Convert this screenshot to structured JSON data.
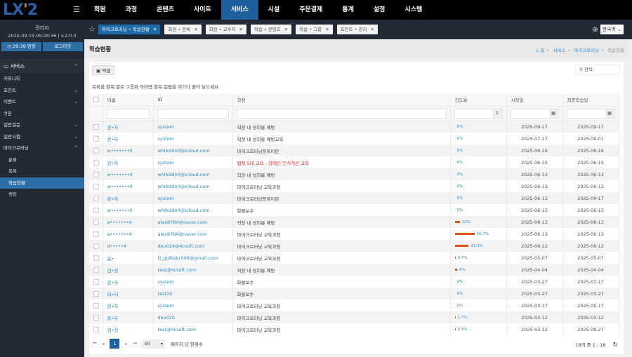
{
  "app": {
    "logo": "LX2"
  },
  "nav": {
    "items": [
      "회원",
      "과정",
      "콘텐츠",
      "사이트",
      "서비스",
      "시설",
      "주문결제",
      "통계",
      "설정",
      "시스템"
    ],
    "active": "서비스"
  },
  "user": {
    "name": "관리자",
    "datetime": "2025-09-19 09:28:36 | v.2.0.0",
    "extend": "29:39 연장",
    "logout": "로그아웃"
  },
  "sidebar": {
    "group": "서비스",
    "items": [
      {
        "label": "커뮤니티",
        "chev": ""
      },
      {
        "label": "포인트",
        "chev": "⌄"
      },
      {
        "label": "이벤트",
        "chev": "⌄"
      },
      {
        "label": "쿠폰",
        "chev": ""
      },
      {
        "label": "일반설문",
        "chev": "⌄"
      },
      {
        "label": "일반시험",
        "chev": "⌄"
      },
      {
        "label": "마이크로러닝",
        "chev": "^"
      }
    ],
    "sub": [
      "분류",
      "목록",
      "학습현황",
      "랭킹"
    ],
    "active": "학습현황"
  },
  "tabs": [
    {
      "label": "마이크로러닝 • 학습현황",
      "active": true
    },
    {
      "label": "회원 • 전체"
    },
    {
      "label": "회원 • 교수자"
    },
    {
      "label": "학습 • 콘텐츠"
    },
    {
      "label": "학습 • 그룹"
    },
    {
      "label": "포인트 • 관리"
    }
  ],
  "language": "한국어",
  "page": {
    "title": "학습현황",
    "breadcrumb": [
      "홈",
      "서비스",
      "마이크로러닝",
      "학습현황"
    ]
  },
  "toolbar": {
    "excel": "엑셀",
    "search_placeholder": "검색",
    "group_hint": "목록을 항목 별로 그룹화 하려면 항목 컬럼을 여기다 끌어 놓으세요."
  },
  "table": {
    "columns": [
      "이름",
      "ID",
      "과정",
      "진도율",
      "시작일",
      "최종학습일"
    ],
    "rows": [
      {
        "name": "관•자",
        "id": "system",
        "course": "직장 내 성희롱 예방",
        "progress": 0,
        "progress_label": "0%",
        "start": "2025-09-17",
        "last": "2025-09-17"
      },
      {
        "name": "관•자",
        "id": "system",
        "course": "직장 내 성희롱 예방교육",
        "progress": 0,
        "progress_label": "0%",
        "start": "2025-07-17",
        "last": "2025-09-01"
      },
      {
        "name": "w•••••••0",
        "id": "whtkddn0@icloud.com",
        "course": "마이크로러닝등록이란",
        "progress": 0,
        "progress_label": "0%",
        "start": "2025-06-16",
        "last": "2025-06-16"
      },
      {
        "name": "관•자",
        "id": "system",
        "course": "법정 5대 교육 - 장애인 인식개선 교육",
        "highlight": true,
        "progress": 0,
        "progress_label": "0%",
        "start": "2025-06-15",
        "last": "2025-06-15"
      },
      {
        "name": "w•••••••0",
        "id": "whtkddn0@icloud.com",
        "course": "직장 내 성희롱 예방",
        "progress": 0,
        "progress_label": "0%",
        "start": "2025-06-13",
        "last": "2025-06-13"
      },
      {
        "name": "w•••••••0",
        "id": "whtkddn0@icloud.com",
        "course": "마이크로러닝 교육과정",
        "progress": 0,
        "progress_label": "0%",
        "start": "2025-06-13",
        "last": "2025-06-13"
      },
      {
        "name": "관•자",
        "id": "system",
        "course": "마이크로러닝등록이란",
        "progress": 0,
        "progress_label": "0%",
        "start": "2025-06-13",
        "last": "2025-09-17"
      },
      {
        "name": "w•••••••0",
        "id": "whtkddn0@icloud.com",
        "course": "화물보수",
        "progress": 0,
        "progress_label": "0%",
        "start": "2025-06-13",
        "last": "2025-06-13"
      },
      {
        "name": "a•••••••4",
        "id": "alex8784@naver.com",
        "course": "직장 내 성희롱 예방",
        "progress": 12,
        "progress_label": "12%",
        "start": "2025-06-13",
        "last": "2025-06-13"
      },
      {
        "name": "a•••••••4",
        "id": "alex8784@naver.com",
        "course": "마이크로러닝 교육과정",
        "progress": 46.7,
        "progress_label": "46.7%",
        "start": "2025-06-13",
        "last": "2025-06-13"
      },
      {
        "name": "d•••••4",
        "id": "dev024@4csoft.com",
        "course": "마이크로러닝 교육과정",
        "progress": 33.3,
        "progress_label": "33.3%",
        "start": "2025-06-12",
        "last": "2025-06-12"
      },
      {
        "name": "윤•",
        "id": "G_gidbstjr000@gmail.com",
        "course": "마이크로러닝 교육과정",
        "progress": 0.7,
        "progress_label": "0.7%",
        "start": "2025-05-07",
        "last": "2025-05-07"
      },
      {
        "name": "김•성",
        "id": "test@4csoft.com",
        "course": "직장 내 성희롱 예방",
        "progress": 6,
        "progress_label": "6%",
        "start": "2025-04-04",
        "last": "2025-04-04"
      },
      {
        "name": "관•자",
        "id": "system",
        "course": "화물보수",
        "progress": 0,
        "progress_label": "0%",
        "start": "2025-03-27",
        "last": "2025-07-17"
      },
      {
        "name": "테•터",
        "id": "test00",
        "course": "화물보수",
        "progress": 0,
        "progress_label": "0%",
        "start": "2025-03-27",
        "last": "2025-03-27"
      },
      {
        "name": "관•자",
        "id": "system",
        "course": "마이크로러닝 교육과정",
        "progress": 0,
        "progress_label": "0%",
        "start": "2025-03-17",
        "last": "2025-09-17"
      },
      {
        "name": "홍•두",
        "id": "dev020",
        "course": "마이크로러닝 교육과정",
        "progress": 1.7,
        "progress_label": "1.7%",
        "start": "2025-03-12",
        "last": "2025-03-12"
      },
      {
        "name": "김•성",
        "id": "test@4csoft.com",
        "course": "마이크로러닝 교육과정",
        "progress": 0.3,
        "progress_label": "0.3%",
        "start": "2025-03-12",
        "last": "2025-08-27"
      }
    ]
  },
  "pager": {
    "current": "1",
    "page_size": "50",
    "page_size_label": "페이지 당 항목수",
    "summary": "18개 중 1 - 18"
  },
  "colors": {
    "accent": "#1e5f9e",
    "progress": "#e5531a",
    "link": "#2a8ccf",
    "sidebar": "#222a36"
  }
}
